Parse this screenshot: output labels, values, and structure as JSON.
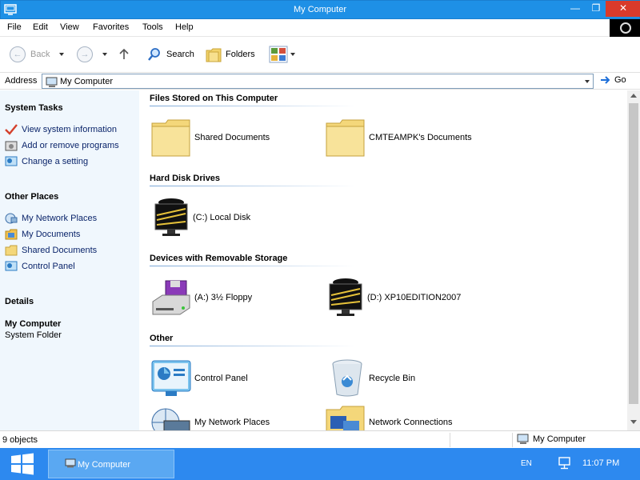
{
  "window": {
    "title": "My Computer"
  },
  "menu": [
    "File",
    "Edit",
    "View",
    "Favorites",
    "Tools",
    "Help"
  ],
  "toolbar": {
    "back": "Back",
    "search": "Search",
    "folders": "Folders"
  },
  "address": {
    "label": "Address",
    "value": "My Computer",
    "go": "Go"
  },
  "left_panel": {
    "system_tasks": {
      "title": "System Tasks",
      "items": [
        "View system information",
        "Add or remove programs",
        "Change a setting"
      ]
    },
    "other_places": {
      "title": "Other Places",
      "items": [
        "My Network Places",
        "My Documents",
        "Shared Documents",
        "Control Panel"
      ]
    },
    "details": {
      "title": "Details",
      "name": "My Computer",
      "type": "System Folder"
    }
  },
  "groups": [
    {
      "title": "Files Stored on This Computer",
      "items": [
        "Shared Documents",
        "CMTEAMPK's Documents"
      ]
    },
    {
      "title": "Hard Disk Drives",
      "items": [
        "(C:) Local Disk"
      ]
    },
    {
      "title": "Devices with Removable Storage",
      "items": [
        "(A:) 3½ Floppy",
        "(D:) XP10EDITION2007"
      ]
    },
    {
      "title": "Other",
      "items": [
        "Control Panel",
        "Recycle Bin",
        "My Network Places",
        "Network Connections"
      ]
    }
  ],
  "status": {
    "count": "9 objects",
    "zone": "My Computer"
  },
  "taskbar": {
    "task": "My Computer",
    "lang": "EN",
    "clock": "11:07 PM"
  },
  "colors": {
    "titlebar": "#1e90e6",
    "close": "#d93a2b",
    "taskbar": "#2d89ef",
    "leftpanel": "#f0f7fd"
  }
}
